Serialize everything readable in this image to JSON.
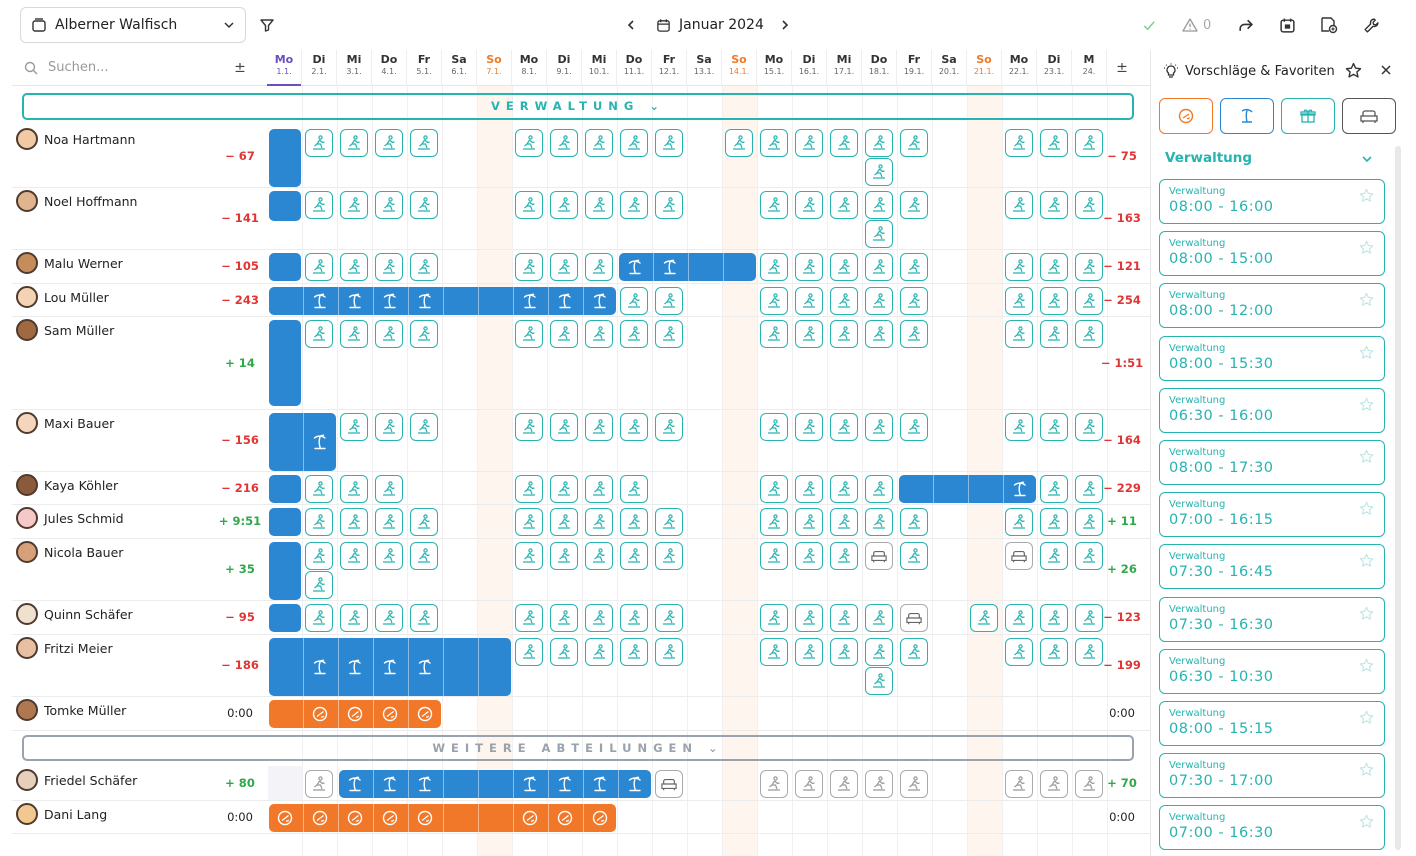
{
  "topbar": {
    "team": "Alberner Walfisch",
    "month": "Januar 2024",
    "warnings": "0"
  },
  "search": {
    "placeholder": "Suchen..."
  },
  "plusminus": "±",
  "days": [
    {
      "wd": "Mo",
      "d": "1.1."
    },
    {
      "wd": "Di",
      "d": "2.1."
    },
    {
      "wd": "Mi",
      "d": "3.1."
    },
    {
      "wd": "Do",
      "d": "4.1."
    },
    {
      "wd": "Fr",
      "d": "5.1."
    },
    {
      "wd": "Sa",
      "d": "6.1."
    },
    {
      "wd": "So",
      "d": "7.1."
    },
    {
      "wd": "Mo",
      "d": "8.1."
    },
    {
      "wd": "Di",
      "d": "9.1."
    },
    {
      "wd": "Mi",
      "d": "10.1."
    },
    {
      "wd": "Do",
      "d": "11.1."
    },
    {
      "wd": "Fr",
      "d": "12.1."
    },
    {
      "wd": "Sa",
      "d": "13.1."
    },
    {
      "wd": "So",
      "d": "14.1."
    },
    {
      "wd": "Mo",
      "d": "15.1."
    },
    {
      "wd": "Di",
      "d": "16.1."
    },
    {
      "wd": "Mi",
      "d": "17.1."
    },
    {
      "wd": "Do",
      "d": "18.1."
    },
    {
      "wd": "Fr",
      "d": "19.1."
    },
    {
      "wd": "Sa",
      "d": "20.1."
    },
    {
      "wd": "So",
      "d": "21.1."
    },
    {
      "wd": "Mo",
      "d": "22.1."
    },
    {
      "wd": "Di",
      "d": "23.1."
    },
    {
      "wd": "M",
      "d": "24."
    }
  ],
  "departments": {
    "main": "VERWALTUNG",
    "other": "WEITERE ABTEILUNGEN"
  },
  "employees": [
    {
      "name": "Noa Hartmann",
      "bal": "− 67",
      "end": "− 75"
    },
    {
      "name": "Noel Hoffmann",
      "bal": "− 141",
      "end": "− 163"
    },
    {
      "name": "Malu Werner",
      "bal": "− 105",
      "end": "− 121"
    },
    {
      "name": "Lou Müller",
      "bal": "− 243",
      "end": "− 254"
    },
    {
      "name": "Sam Müller",
      "bal": "+ 14",
      "end": "− 1:51"
    },
    {
      "name": "Maxi Bauer",
      "bal": "− 156",
      "end": "− 164"
    },
    {
      "name": "Kaya Köhler",
      "bal": "− 216",
      "end": "− 229"
    },
    {
      "name": "Jules Schmid",
      "bal": "+ 9:51",
      "end": "+ 11"
    },
    {
      "name": "Nicola Bauer",
      "bal": "+ 35",
      "end": "+ 26"
    },
    {
      "name": "Quinn Schäfer",
      "bal": "− 95",
      "end": "− 123"
    },
    {
      "name": "Fritzi Meier",
      "bal": "− 186",
      "end": "− 199"
    },
    {
      "name": "Tomke Müller",
      "bal": "0:00",
      "end": "0:00"
    },
    {
      "name": "Friedel Schäfer",
      "bal": "+ 80",
      "end": "+ 70"
    },
    {
      "name": "Dani Lang",
      "bal": "0:00",
      "end": "0:00"
    }
  ],
  "panel": {
    "title": "Vorschläge & Favoriten",
    "group": "Verwaltung",
    "shifts": [
      {
        "label": "Verwaltung",
        "time": "08:00 - 16:00"
      },
      {
        "label": "Verwaltung",
        "time": "08:00 - 15:00"
      },
      {
        "label": "Verwaltung",
        "time": "08:00 - 12:00"
      },
      {
        "label": "Verwaltung",
        "time": "08:00 - 15:30"
      },
      {
        "label": "Verwaltung",
        "time": "06:30 - 16:00"
      },
      {
        "label": "Verwaltung",
        "time": "08:00 - 17:30"
      },
      {
        "label": "Verwaltung",
        "time": "07:00 - 16:15"
      },
      {
        "label": "Verwaltung",
        "time": "07:30 - 16:45"
      },
      {
        "label": "Verwaltung",
        "time": "07:30 - 16:30"
      },
      {
        "label": "Verwaltung",
        "time": "06:30 - 10:30"
      },
      {
        "label": "Verwaltung",
        "time": "08:00 - 15:15"
      },
      {
        "label": "Verwaltung",
        "time": "07:30 - 17:00"
      },
      {
        "label": "Verwaltung",
        "time": "07:00 - 16:30"
      }
    ]
  },
  "colors": {
    "teal": "#27b3b0",
    "blue": "#2b87d1",
    "orange": "#f07828",
    "sunday": "#ee7a2a",
    "today": "#6a4fc0",
    "neg": "#e03535",
    "pos": "#2fa84a"
  }
}
